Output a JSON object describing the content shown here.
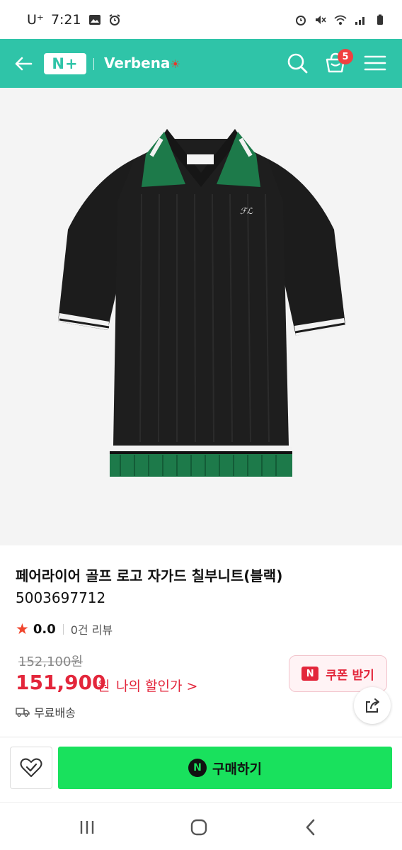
{
  "status_bar": {
    "carrier": "U⁺",
    "time": "7:21"
  },
  "header": {
    "logo": "N+",
    "brand": "Verbena",
    "cart_count": "5",
    "accent_color": "#2fc4a8"
  },
  "product": {
    "title": "페어라이어 골프 로고 자가드 칠부니트(블랙)",
    "code": "5003697712",
    "rating": "0.0",
    "review_count": "0건 리뷰",
    "original_price": "152,100원",
    "price": "151,900",
    "currency": "원",
    "my_discount": "나의 할인가 >",
    "shipping": "무료배송",
    "coupon_label": "쿠폰 받기",
    "coupon_badge": "N",
    "price_color": "#e3263b"
  },
  "actions": {
    "buy_label": "구매하기",
    "buy_badge": "N",
    "buy_color": "#19e15d"
  },
  "icons": {
    "back": "back-arrow-icon",
    "search": "search-icon",
    "cart": "cart-icon",
    "menu": "hamburger-menu-icon",
    "share": "share-icon",
    "favorite": "heart-check-icon",
    "truck": "truck-icon"
  }
}
